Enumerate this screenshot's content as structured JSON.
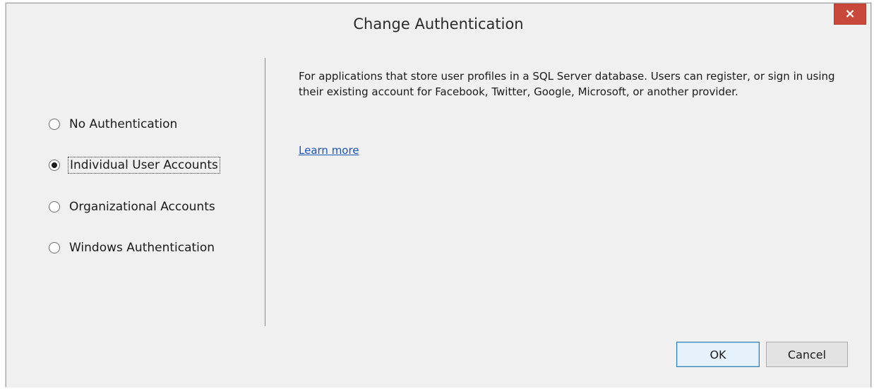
{
  "dialog": {
    "title": "Change Authentication",
    "close_label": "×"
  },
  "options": [
    {
      "label": "No Authentication",
      "selected": false
    },
    {
      "label": "Individual User Accounts",
      "selected": true
    },
    {
      "label": "Organizational Accounts",
      "selected": false
    },
    {
      "label": "Windows Authentication",
      "selected": false
    }
  ],
  "description": {
    "text": "For applications that store user profiles in a SQL Server database. Users can register, or sign in using their existing account for Facebook, Twitter, Google, Microsoft, or another provider.",
    "link_label": "Learn more"
  },
  "buttons": {
    "ok_label": "OK",
    "cancel_label": "Cancel"
  },
  "colors": {
    "close_button": "#c9483c",
    "link": "#1a56b4",
    "default_button_border": "#3c7fb1"
  }
}
